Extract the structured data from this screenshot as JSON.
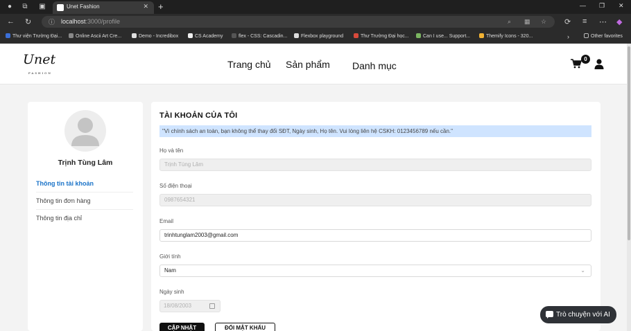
{
  "browser": {
    "tab_title": "Unet Fashion",
    "url_host": "localhost",
    "url_rest": ":3000/profile",
    "bookmarks": [
      "Thư viện Trường Đại...",
      "Online Ascii Art Cre...",
      "Demo - Incredibox",
      "CS Academy",
      "flex - CSS: Cascadin...",
      "Flexbox playground",
      "Thư Trường Đại học...",
      "Can I use... Support...",
      "Themify Icons - 320..."
    ],
    "other_favorites": "Other favorites"
  },
  "header": {
    "logo_text": "Unet",
    "logo_sub": "FASHION",
    "nav": [
      "Trang chủ",
      "Sản phẩm",
      "Danh mục"
    ],
    "cart_count": "0"
  },
  "sidebar": {
    "user_name": "Trịnh Tùng Lâm",
    "items": [
      "Thông tin tài khoản",
      "Thông tin đơn hàng",
      "Thông tin địa chỉ"
    ]
  },
  "account": {
    "title": "TÀI KHOẢN CỦA TÔI",
    "notice": "\"Vì chính sách an toàn, bạn không thể thay đổi SĐT, Ngày sinh, Họ tên. Vui lòng liên hệ CSKH: 0123456789 nếu cần.\"",
    "name_label": "Họ và tên",
    "name_value": "Trịnh Tùng Lâm",
    "phone_label": "Số điện thoại",
    "phone_value": "0987654321",
    "email_label": "Email",
    "email_value": "trinhtunglam2003@gmail.com",
    "gender_label": "Giới tính",
    "gender_value": "Nam",
    "birth_label": "Ngày sinh",
    "birth_value": "18/08/2003",
    "update_button": "CẬP NHẬT",
    "password_button": "ĐỔI MẬT KHẨU"
  },
  "chat": {
    "label": "Trò chuyện với AI"
  }
}
